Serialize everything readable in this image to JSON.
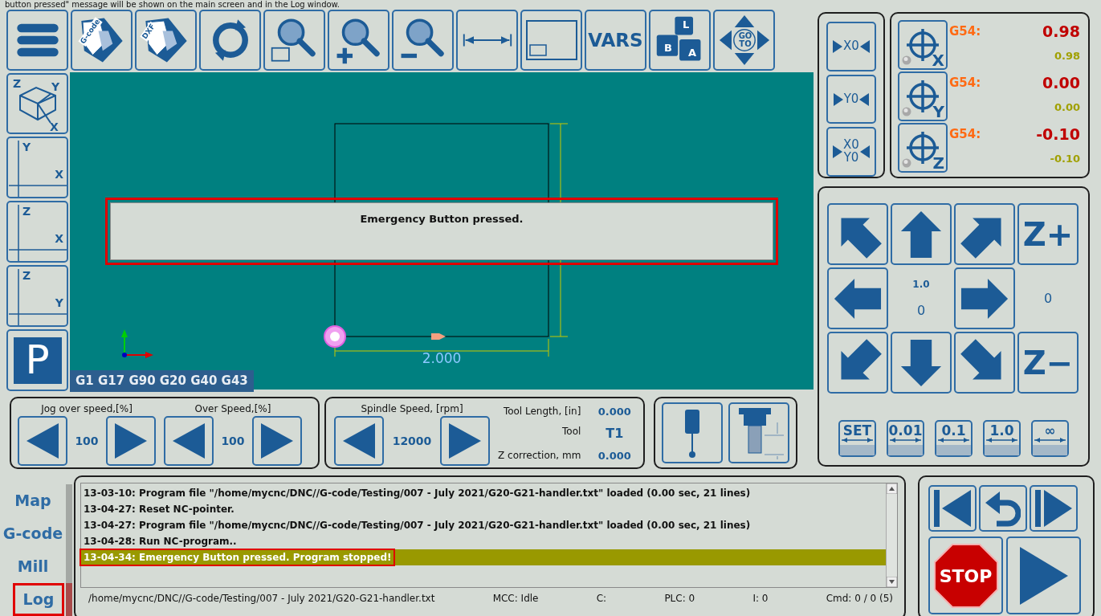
{
  "caption": "button pressed\" message will be shown on the main screen and in the Log window.",
  "toolbar": [
    {
      "kind": "menu"
    },
    {
      "kind": "gcode-file",
      "label": "G-code"
    },
    {
      "kind": "dxf-file",
      "label": "DXF"
    },
    {
      "kind": "refresh"
    },
    {
      "kind": "zoom-window"
    },
    {
      "kind": "zoom-in"
    },
    {
      "kind": "zoom-out"
    },
    {
      "kind": "fit-width"
    },
    {
      "kind": "fit-screen"
    },
    {
      "kind": "vars",
      "label": "VARS"
    },
    {
      "kind": "keys",
      "labels": [
        "L",
        "B",
        "A"
      ]
    },
    {
      "kind": "goto",
      "labels": [
        "GO",
        "TO"
      ]
    }
  ],
  "view_buttons": [
    {
      "kind": "iso",
      "axes": [
        "Z",
        "Y",
        "X"
      ]
    },
    {
      "kind": "plane",
      "axes": [
        "Y",
        "X"
      ]
    },
    {
      "kind": "plane",
      "axes": [
        "Z",
        "X"
      ]
    },
    {
      "kind": "plane",
      "axes": [
        "Z",
        "Y"
      ]
    },
    {
      "kind": "park",
      "label": "P"
    }
  ],
  "canvas": {
    "dimension": "2.000",
    "modal_codes": "G1  G17 G90 G20 G40 G43",
    "alert": {
      "message": "Emergency Button pressed.",
      "highlighted": true
    }
  },
  "overrides": [
    {
      "label": "Jog over speed,[%]",
      "value": "100"
    },
    {
      "label": "Over Speed,[%]",
      "value": "100"
    }
  ],
  "spindle": {
    "label": "Spindle Speed, [rpm]",
    "value": "12000"
  },
  "tool_info": [
    {
      "label": "Tool Length, [in]",
      "value": "0.000"
    },
    {
      "label": "Tool",
      "value": "T1"
    },
    {
      "label": "Z correction, mm",
      "value": "0.000"
    }
  ],
  "tool_buttons": [
    {
      "kind": "probe"
    },
    {
      "kind": "tool-length"
    }
  ],
  "zero_buttons": [
    {
      "lines": [
        "X0"
      ]
    },
    {
      "lines": [
        "Y0"
      ]
    },
    {
      "lines": [
        "X0",
        "Y0"
      ]
    }
  ],
  "dro": [
    {
      "axis": "X",
      "offset": "G54:",
      "value": "0.98",
      "machine": "0.98"
    },
    {
      "axis": "Y",
      "offset": "G54:",
      "value": "0.00",
      "machine": "0.00"
    },
    {
      "axis": "Z",
      "offset": "G54:",
      "value": "-0.10",
      "machine": "-0.10"
    }
  ],
  "jog": [
    {
      "kind": "arrow-nw"
    },
    {
      "kind": "arrow-n"
    },
    {
      "kind": "arrow-ne"
    },
    {
      "kind": "z",
      "label": "Z+"
    },
    {
      "kind": "arrow-w"
    },
    {
      "kind": "xy-readout",
      "step": "1.0",
      "value": "0"
    },
    {
      "kind": "arrow-e"
    },
    {
      "kind": "z-readout",
      "value": "0"
    },
    {
      "kind": "arrow-sw"
    },
    {
      "kind": "arrow-s"
    },
    {
      "kind": "arrow-se"
    },
    {
      "kind": "z",
      "label": "Z−"
    }
  ],
  "steps": [
    "SET",
    "0.01",
    "0.1",
    "1.0",
    "∞"
  ],
  "side_tabs": [
    {
      "label": "Map",
      "selected": false,
      "highlighted": false
    },
    {
      "label": "G-code",
      "selected": false,
      "highlighted": false
    },
    {
      "label": "Mill",
      "selected": false,
      "highlighted": false
    },
    {
      "label": "Log",
      "selected": true,
      "highlighted": true
    }
  ],
  "log": [
    {
      "text": "13-03-10: Program file \"/home/mycnc/DNC//G-code/Testing/007 - July 2021/G20-G21-handler.txt\" loaded (0.00 sec, 21 lines)",
      "selected": false,
      "highlighted": false
    },
    {
      "text": "13-04-27: Reset NC-pointer.",
      "selected": false,
      "highlighted": false
    },
    {
      "text": "13-04-27: Program file \"/home/mycnc/DNC//G-code/Testing/007 - July 2021/G20-G21-handler.txt\" loaded (0.00 sec, 21 lines)",
      "selected": false,
      "highlighted": false
    },
    {
      "text": "13-04-28: Run NC-program..",
      "selected": false,
      "highlighted": false
    },
    {
      "text": "13-04-34: Emergency Button pressed. Program stopped!",
      "selected": true,
      "highlighted": true
    }
  ],
  "status_bar": [
    "/home/mycnc/DNC//G-code/Testing/007 - July 2021/G20-G21-handler.txt",
    "MCC:  Idle",
    "C:",
    "PLC:  0",
    "I:  0",
    "Cmd:  0  /  0 (5)"
  ],
  "run_controls": [
    {
      "kind": "first"
    },
    {
      "kind": "rewind"
    },
    {
      "kind": "next"
    },
    {
      "kind": "stop",
      "label": "STOP"
    },
    {
      "kind": "start"
    }
  ]
}
